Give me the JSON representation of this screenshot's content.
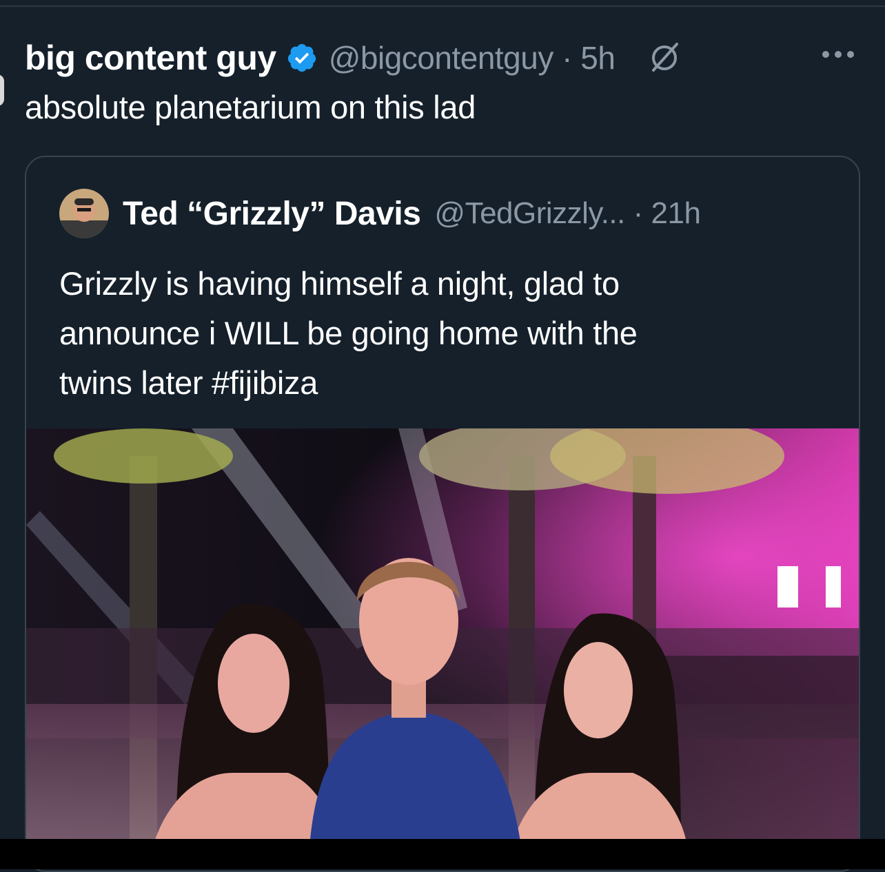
{
  "tweet": {
    "author_name": "big content guy",
    "verified_icon": "verified-badge-icon",
    "handle": "@bigcontentguy",
    "separator": "·",
    "time": "5h",
    "text": "absolute planetarium on this lad",
    "grok_icon": "grok-icon",
    "more_icon": "more-options-icon"
  },
  "quoted_tweet": {
    "author_name": "Ted “Grizzly” Davis",
    "handle": "@TedGrizzly...",
    "separator": "·",
    "time": "21h",
    "text_line1": "Grizzly is having himself a night, glad to",
    "text_line2": "announce i WILL be going home with the",
    "text_line3_prefix": "twins later ",
    "hashtag": "#fijibiza",
    "image": "photo-three-people-at-night-party"
  },
  "colors": {
    "background": "#15202b",
    "secondary_text": "#8b98a5",
    "verified_blue": "#1d9bf0",
    "border": "#38444d"
  }
}
